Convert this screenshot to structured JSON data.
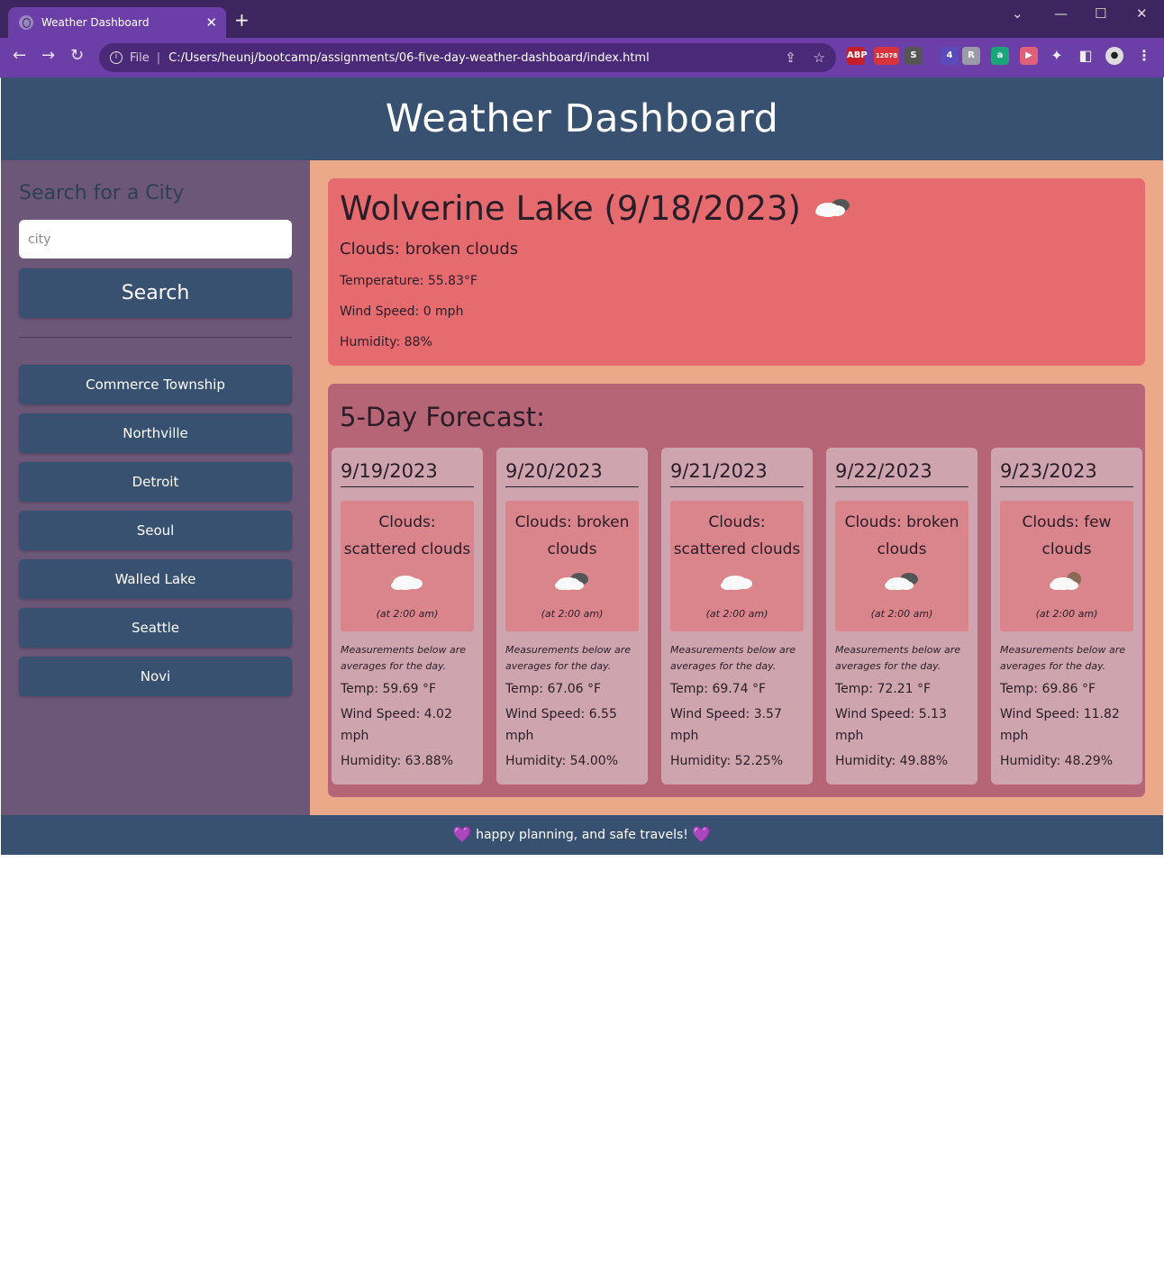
{
  "browser": {
    "tab_title": "Weather Dashboard",
    "file_label": "File",
    "url": "C:/Users/heunj/bootcamp/assignments/06-five-day-weather-dashboard/index.html",
    "extensions": [
      {
        "name": "adblock-icon",
        "label": "ABP",
        "color": "#c41e2a"
      },
      {
        "name": "gmail-checker-icon",
        "label": "12078",
        "color": "#d9333f"
      },
      {
        "name": "script-icon",
        "label": "S",
        "color": "#555555"
      },
      {
        "name": "tab-counter-icon",
        "label": "4",
        "color": "#5a4bbd"
      },
      {
        "name": "r-icon",
        "label": "R",
        "color": "#9a9aa8"
      },
      {
        "name": "a-icon",
        "label": "a",
        "color": "#1aa57a"
      },
      {
        "name": "video-icon",
        "label": "▶",
        "color": "#e0607a"
      }
    ]
  },
  "header": {
    "title": "Weather Dashboard"
  },
  "sidebar": {
    "search_title": "Search for a City",
    "search_placeholder": "city",
    "search_button": "Search",
    "history": [
      "Commerce Township",
      "Northville",
      "Detroit",
      "Seoul",
      "Walled Lake",
      "Seattle",
      "Novi"
    ]
  },
  "current": {
    "title": "Wolverine Lake (9/18/2023)",
    "icon": "broken-clouds-icon",
    "description": "Clouds: broken clouds",
    "temperature": "Temperature: 55.83°F",
    "wind": "Wind Speed: 0 mph",
    "humidity": "Humidity: 88%"
  },
  "forecast": {
    "title": "5-Day Forecast:",
    "note": "Measurements below are averages for the day.",
    "days": [
      {
        "date": "9/19/2023",
        "description": "Clouds: scattered clouds",
        "icon": "scattered-clouds-icon",
        "time": "(at 2:00 am)",
        "temp": "Temp: 59.69 °F",
        "wind": "Wind Speed: 4.02 mph",
        "humidity": "Humidity: 63.88%"
      },
      {
        "date": "9/20/2023",
        "description": "Clouds: broken clouds",
        "icon": "broken-clouds-icon",
        "time": "(at 2:00 am)",
        "temp": "Temp: 67.06 °F",
        "wind": "Wind Speed: 6.55 mph",
        "humidity": "Humidity: 54.00%"
      },
      {
        "date": "9/21/2023",
        "description": "Clouds: scattered clouds",
        "icon": "scattered-clouds-icon",
        "time": "(at 2:00 am)",
        "temp": "Temp: 69.74 °F",
        "wind": "Wind Speed: 3.57 mph",
        "humidity": "Humidity: 52.25%"
      },
      {
        "date": "9/22/2023",
        "description": "Clouds: broken clouds",
        "icon": "broken-clouds-icon",
        "time": "(at 2:00 am)",
        "temp": "Temp: 72.21 °F",
        "wind": "Wind Speed: 5.13 mph",
        "humidity": "Humidity: 49.88%"
      },
      {
        "date": "9/23/2023",
        "description": "Clouds: few clouds",
        "icon": "few-clouds-icon",
        "time": "(at 2:00 am)",
        "temp": "Temp: 69.86 °F",
        "wind": "Wind Speed: 11.82 mph",
        "humidity": "Humidity: 48.29%"
      }
    ]
  },
  "footer": {
    "text": "happy planning, and safe travels!",
    "heart": "💜"
  },
  "colors": {
    "header_bg": "#385170",
    "sidebar_bg": "#6c5778",
    "main_bg": "#eba98a",
    "current_bg": "#e56b6f",
    "forecast_bg": "#b56576",
    "card_bg": "#cea5ae",
    "card_box_bg": "#da848b"
  }
}
